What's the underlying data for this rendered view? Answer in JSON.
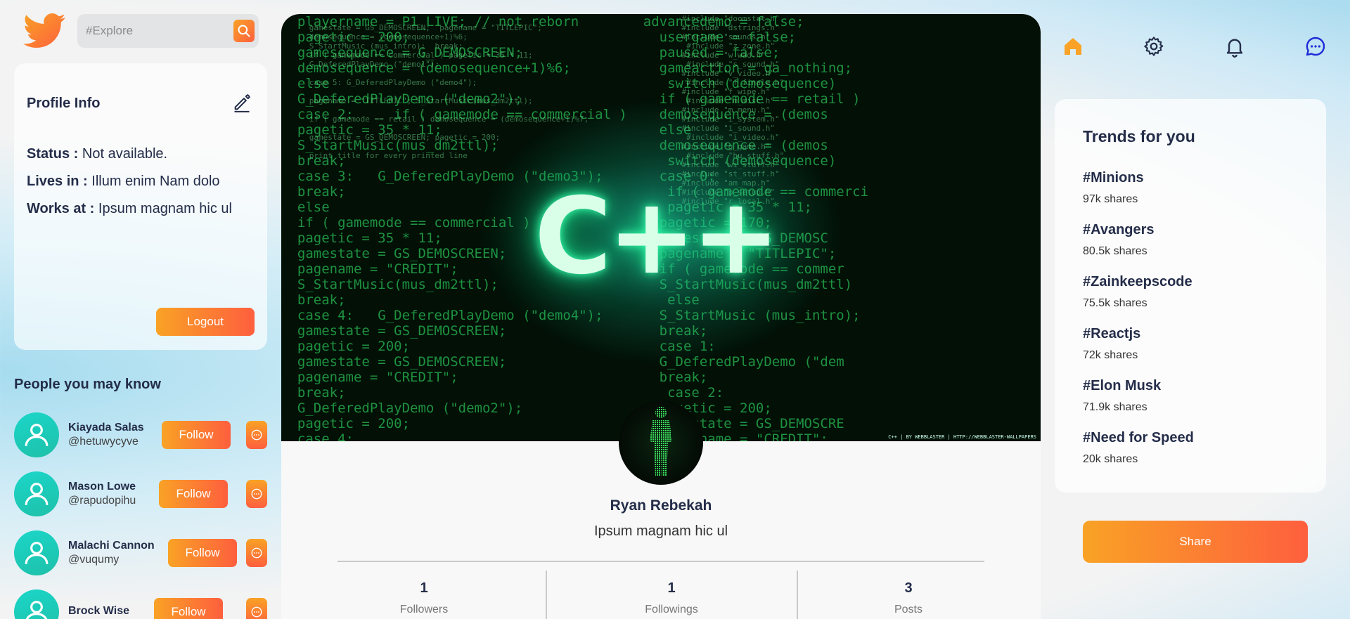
{
  "search": {
    "placeholder": "#Explore"
  },
  "profile_card": {
    "title": "Profile Info",
    "status_label": "Status :",
    "status_value": "Not available.",
    "lives_label": "Lives in :",
    "lives_value": "Illum enim Nam dolo",
    "works_label": "Works at :",
    "works_value": "Ipsum magnam hic ul",
    "logout_label": "Logout"
  },
  "people": {
    "title": "People you may know",
    "follow_label": "Follow",
    "items": [
      {
        "name": "Kiayada Salas",
        "handle": "@hetuwycyve"
      },
      {
        "name": "Mason Lowe",
        "handle": "@rapudopihu"
      },
      {
        "name": "Malachi Cannon",
        "handle": "@vuqumy"
      },
      {
        "name": "Brock Wise",
        "handle": ""
      }
    ]
  },
  "cover": {
    "title_text": "C++"
  },
  "profile": {
    "name": "Ryan Rebekah",
    "bio": "Ipsum magnam hic ul",
    "stats": [
      {
        "value": "1",
        "label": "Followers"
      },
      {
        "value": "1",
        "label": "Followings"
      },
      {
        "value": "3",
        "label": "Posts"
      }
    ]
  },
  "nav": {
    "icons": [
      "home-icon",
      "gear-icon",
      "bell-icon",
      "chat-icon"
    ],
    "active": "home-icon",
    "accent": "#f9a225"
  },
  "trends": {
    "title": "Trends for you",
    "items": [
      {
        "tag": "#Minions",
        "shares": "97k shares"
      },
      {
        "tag": "#Avangers",
        "shares": "80.5k shares"
      },
      {
        "tag": "#Zainkeepscode",
        "shares": "75.5k shares"
      },
      {
        "tag": "#Reactjs",
        "shares": "72k shares"
      },
      {
        "tag": "#Elon Musk",
        "shares": "71.9k shares"
      },
      {
        "tag": "#Need for Speed",
        "shares": "20k shares"
      }
    ]
  },
  "share_label": "Share",
  "colors": {
    "gradient_start": "#f9a225",
    "gradient_end": "#fe5f3e",
    "text": "#242d49"
  }
}
